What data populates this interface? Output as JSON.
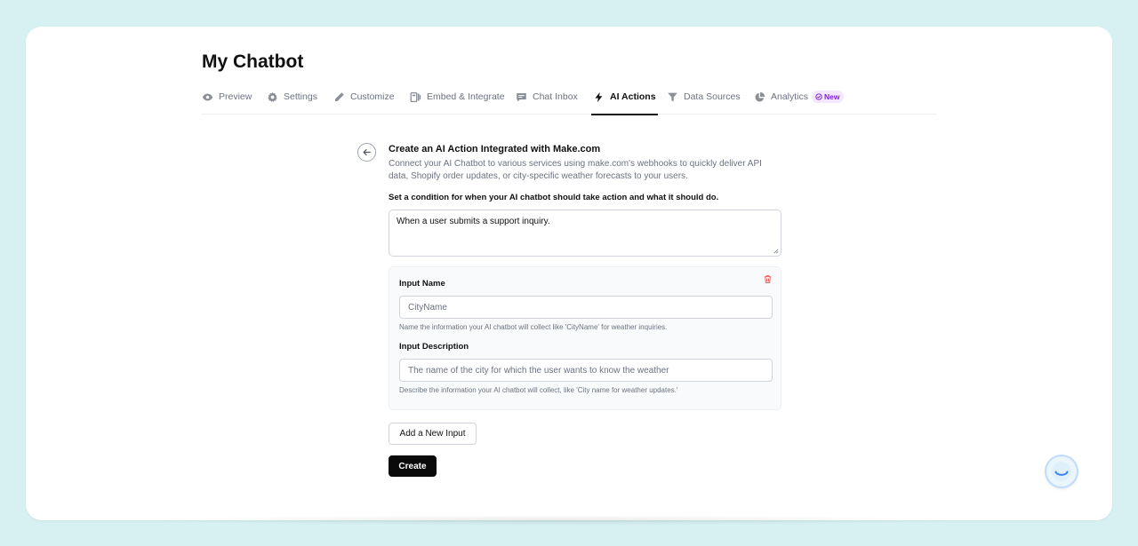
{
  "page": {
    "title": "My Chatbot"
  },
  "tabs": [
    {
      "label": "Preview",
      "icon": "eye-icon"
    },
    {
      "label": "Settings",
      "icon": "gear-icon"
    },
    {
      "label": "Customize",
      "icon": "pencil-icon"
    },
    {
      "label": "Embed & Integrate",
      "icon": "embed-icon"
    },
    {
      "label": "Chat Inbox",
      "icon": "chat-icon"
    },
    {
      "label": "AI Actions",
      "icon": "bolt-icon",
      "active": true
    },
    {
      "label": "Data Sources",
      "icon": "filter-icon"
    },
    {
      "label": "Analytics",
      "icon": "pie-icon",
      "badge": "New"
    }
  ],
  "form": {
    "heading": "Create an AI Action Integrated with Make.com",
    "description": "Connect your AI Chatbot to various services using make.com's webhooks to quickly deliver API data, Shopify order updates, or city-specific weather forecasts to your users.",
    "condition_label": "Set a condition for when your AI chatbot should take action and what it should do.",
    "condition_value": "When a user submits a support inquiry.",
    "input_card": {
      "name_label": "Input Name",
      "name_placeholder": "CityName",
      "name_help": "Name the information your AI chatbot will collect like 'CityName' for weather inquiries.",
      "desc_label": "Input Description",
      "desc_placeholder": "The name of the city for which the user wants to know the weather",
      "desc_help": "Describe the information your AI chatbot will collect, like 'City name for weather updates.'"
    },
    "add_input_label": "Add a New Input",
    "create_label": "Create"
  },
  "colors": {
    "accent": "#0a0a0a",
    "badge_bg": "#f3e8ff",
    "badge_text": "#7e22ce",
    "danger": "#ef4444"
  }
}
